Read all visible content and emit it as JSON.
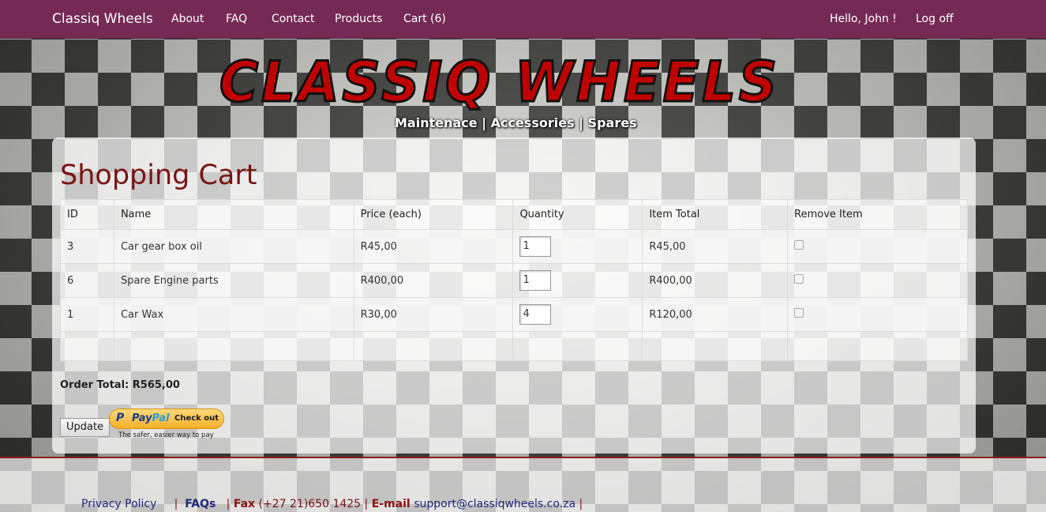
{
  "navbar": {
    "brand": "Classiq Wheels",
    "links": [
      "About",
      "FAQ",
      "Contact",
      "Products",
      "Cart (6)"
    ],
    "greeting": "Hello, John !",
    "logoff": "Log off"
  },
  "header": {
    "logo_text": "CLASSIQ WHEELS",
    "tagline": "Maintenace | Accessories | Spares"
  },
  "cart": {
    "title": "Shopping Cart",
    "columns": [
      "ID",
      "Name",
      "Price (each)",
      "Quantity",
      "Item Total",
      "Remove Item"
    ],
    "rows": [
      {
        "id": "3",
        "name": "Car gear box oil",
        "price": "R45,00",
        "qty": "1",
        "total": "R45,00",
        "remove": false
      },
      {
        "id": "6",
        "name": "Spare Engine parts",
        "price": "R400,00",
        "qty": "1",
        "total": "R400,00",
        "remove": false
      },
      {
        "id": "1",
        "name": "Car Wax",
        "price": "R30,00",
        "qty": "4",
        "total": "R120,00",
        "remove": false
      }
    ],
    "order_total": "Order Total: R565,00",
    "update_label": "Update"
  },
  "paypal": {
    "pay": "Pay",
    "pal": "Pal",
    "checkout": "Check out",
    "tagline": "The safer, easier way to pay"
  },
  "footer": {
    "privacy": "Privacy Policy",
    "faqs": "FAQs",
    "fax_label": "Fax",
    "fax_value": "(+27 21)650 1425",
    "email_label": "E-mail",
    "email_value": "support@classiqwheels.co.za"
  },
  "colors": {
    "navbar": "#752a55",
    "title": "#7a1212",
    "logo_red": "#c00000"
  }
}
